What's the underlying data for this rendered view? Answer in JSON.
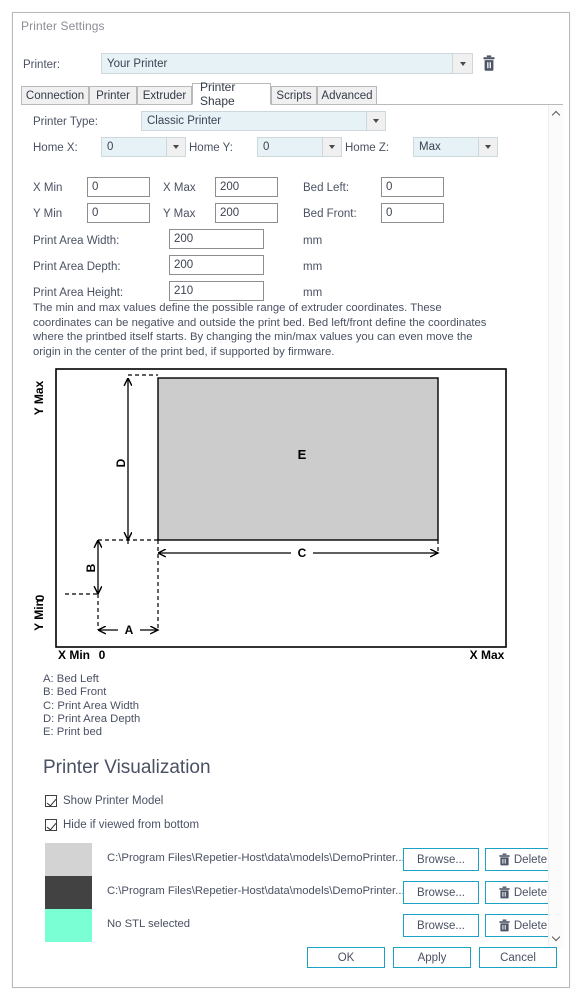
{
  "window": {
    "title": "Printer Settings"
  },
  "printer_row": {
    "label": "Printer:",
    "value": "Your Printer",
    "delete_icon": "trash-icon",
    "dropdown_icon": "chevron-down-icon"
  },
  "tabs": [
    {
      "label": "Connection",
      "active": false
    },
    {
      "label": "Printer",
      "active": false
    },
    {
      "label": "Extruder",
      "active": false
    },
    {
      "label": "Printer Shape",
      "active": true
    },
    {
      "label": "Scripts",
      "active": false
    },
    {
      "label": "Advanced",
      "active": false
    }
  ],
  "form": {
    "printer_type": {
      "label": "Printer Type:",
      "value": "Classic Printer"
    },
    "home_x": {
      "label": "Home X:",
      "value": "0"
    },
    "home_y": {
      "label": "Home Y:",
      "value": "0"
    },
    "home_z": {
      "label": "Home Z:",
      "value": "Max"
    },
    "x_min": {
      "label": "X Min",
      "value": "0"
    },
    "x_max": {
      "label": "X Max",
      "value": "200"
    },
    "bed_left": {
      "label": "Bed Left:",
      "value": "0"
    },
    "y_min": {
      "label": "Y Min",
      "value": "0"
    },
    "y_max": {
      "label": "Y Max",
      "value": "200"
    },
    "bed_front": {
      "label": "Bed Front:",
      "value": "0"
    },
    "print_area_width": {
      "label": "Print Area Width:",
      "value": "200",
      "unit": "mm"
    },
    "print_area_depth": {
      "label": "Print Area Depth:",
      "value": "200",
      "unit": "mm"
    },
    "print_area_height": {
      "label": "Print Area Height:",
      "value": "210",
      "unit": "mm"
    },
    "description": "The min and max values define the possible range of extruder coordinates. These coordinates can be negative and outside the print bed. Bed left/front define the coordinates where the printbed itself starts. By changing the min/max values you can even move the origin in the center of the print bed, if supported by firmware."
  },
  "diagram": {
    "axis_y_max": "Y Max",
    "axis_y_min": "Y Min",
    "axis_y_zero": "0",
    "axis_x_min": "X Min",
    "axis_x_zero": "0",
    "axis_x_max": "X Max",
    "dim_a": "A",
    "dim_b": "B",
    "dim_c": "C",
    "dim_d": "D",
    "bed_label": "E",
    "bed_fill": "#cccccc"
  },
  "legend": [
    "A: Bed Left",
    "B: Bed Front",
    "C: Print Area Width",
    "D: Print Area Depth",
    "E: Print bed"
  ],
  "visualization": {
    "title": "Printer Visualization",
    "checkboxes": [
      {
        "label": "Show Printer Model",
        "checked": true
      },
      {
        "label": "Hide if viewed from bottom",
        "checked": true
      }
    ],
    "rows": [
      {
        "color": "#d3d3d3",
        "path": "C:\\Program Files\\Repetier-Host\\data\\models\\DemoPrinter...",
        "browse_label": "Browse...",
        "delete_label": "Delete"
      },
      {
        "color": "#424242",
        "path": "C:\\Program Files\\Repetier-Host\\data\\models\\DemoPrinter...",
        "browse_label": "Browse...",
        "delete_label": "Delete"
      },
      {
        "color": "#7affd4",
        "path": "No STL selected",
        "browse_label": "Browse...",
        "delete_label": "Delete"
      }
    ]
  },
  "footer": {
    "ok": "OK",
    "apply": "Apply",
    "cancel": "Cancel"
  },
  "colors": {
    "accent": "#1ba1c5",
    "field_bg": "#e7f2f7",
    "text": "#4a5163"
  }
}
